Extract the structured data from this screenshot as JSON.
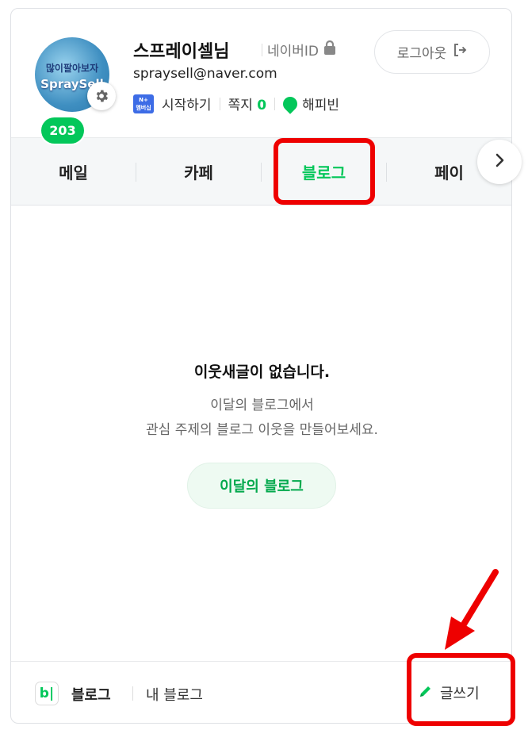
{
  "profile": {
    "avatar_line1": "많이팔아보자",
    "avatar_line2": "SpraySell",
    "name": "스프레이셀님",
    "naver_id_label": "네이버ID",
    "email": "spraysell@naver.com",
    "membership_icon_top": "N+",
    "membership_icon_bottom": "멤버십",
    "start_label": "시작하기",
    "note_label": "쪽지",
    "note_count": "0",
    "happybean_label": "해피빈",
    "logout_label": "로그아웃"
  },
  "tabs": {
    "mail_badge": "203",
    "items": [
      {
        "label": "메일"
      },
      {
        "label": "카페"
      },
      {
        "label": "블로그"
      },
      {
        "label": "페이"
      }
    ]
  },
  "empty_state": {
    "title": "이웃새글이 없습니다.",
    "desc_line1": "이달의 블로그에서",
    "desc_line2": "관심 주제의 블로그 이웃을 만들어보세요.",
    "cta_label": "이달의 블로그"
  },
  "footer": {
    "icon_letter": "b|",
    "blog_label": "블로그",
    "my_blog_label": "내 블로그",
    "write_label": "글쓰기"
  },
  "colors": {
    "accent": "#03c75a",
    "annotation": "#ee0000"
  }
}
